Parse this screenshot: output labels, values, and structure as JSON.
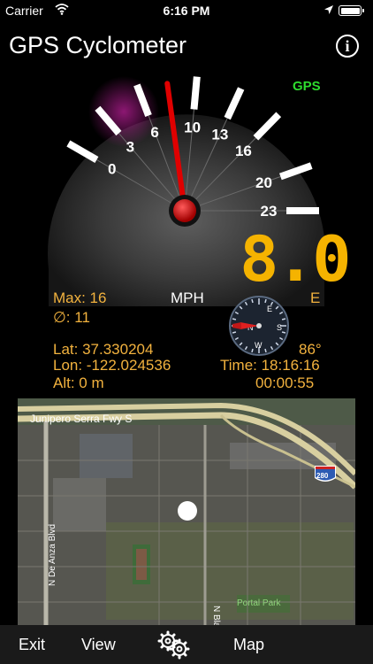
{
  "status_bar": {
    "carrier": "Carrier",
    "time": "6:16 PM",
    "wifi_icon": "wifi-icon",
    "location_icon": "location-arrow-icon",
    "battery_icon": "battery-icon"
  },
  "header": {
    "title": "GPS Cyclometer",
    "info_icon": "info-icon",
    "info_glyph": "i"
  },
  "gauge": {
    "ticks": [
      "0",
      "3",
      "6",
      "10",
      "13",
      "16",
      "20",
      "23"
    ],
    "speed_value": 8.0,
    "gps_label": "GPS",
    "unit_label": "MPH"
  },
  "readout": {
    "speed_display": "8.0",
    "heading": "E",
    "max": "Max: 16",
    "avg": "∅: 11",
    "lat": "Lat: 37.330204",
    "lon": "Lon: -122.024536",
    "alt": "Alt: 0 m",
    "bearing": "86°",
    "time": "Time: 18:16:16",
    "duration": "00:00:55"
  },
  "compass": {
    "n": "N",
    "e": "E",
    "s": "S",
    "w": "W"
  },
  "map": {
    "labels": {
      "freeway": "Junipero Serra Fwy S",
      "shield": "280",
      "de_anza": "N De Anza Blvd",
      "blaney": "N Blaney Ave",
      "park": "Portal Park"
    },
    "location_dot_icon": "current-location-icon"
  },
  "toolbar": {
    "exit": "Exit",
    "view": "View",
    "settings_icon": "gears-icon",
    "map": "Map"
  },
  "colors": {
    "accent": "#f2b23e",
    "digital": "#f5b300",
    "gps": "#2edc2e",
    "needle": "#e00000"
  }
}
